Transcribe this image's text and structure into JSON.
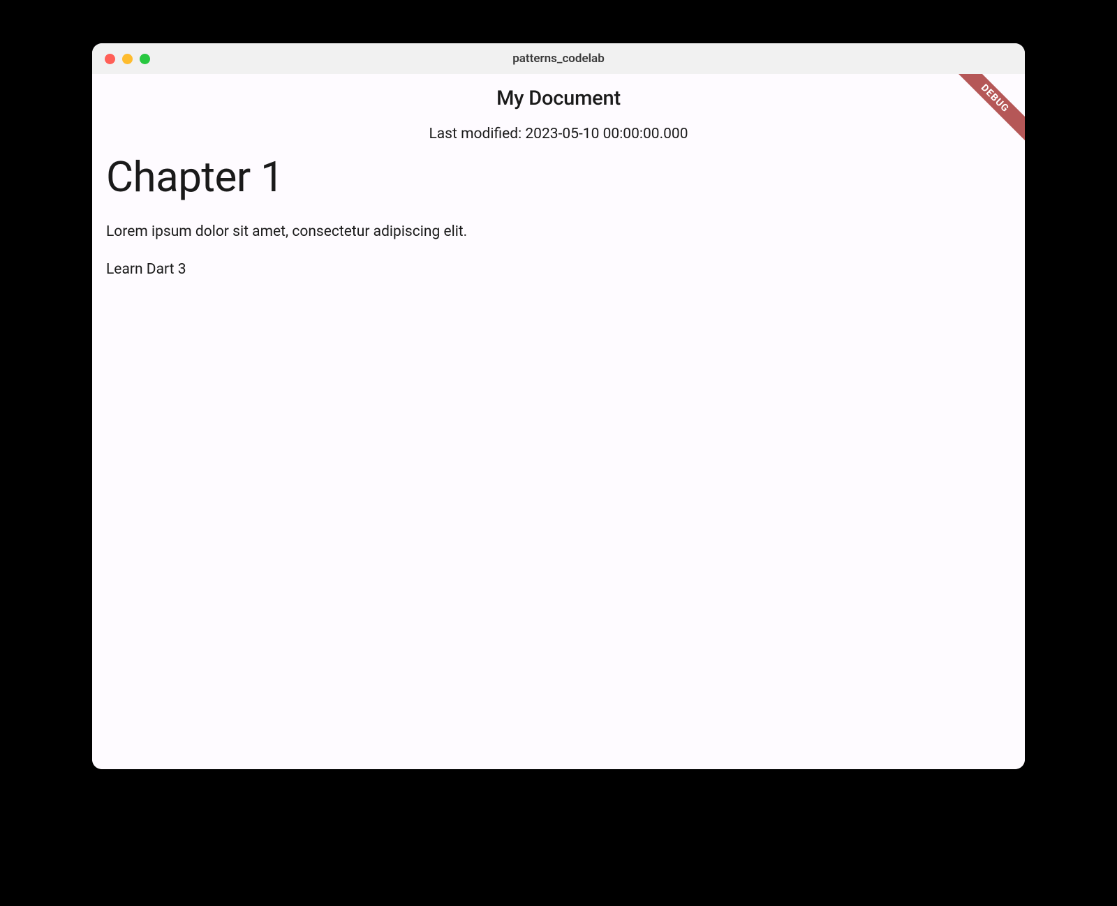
{
  "window": {
    "title": "patterns_codelab"
  },
  "debug": {
    "label": "DEBUG"
  },
  "header": {
    "title": "My Document",
    "subtitle": "Last modified: 2023-05-10 00:00:00.000"
  },
  "content": {
    "heading": "Chapter 1",
    "paragraph": "Lorem ipsum dolor sit amet, consectetur adipiscing elit.",
    "item": "Learn Dart 3"
  }
}
